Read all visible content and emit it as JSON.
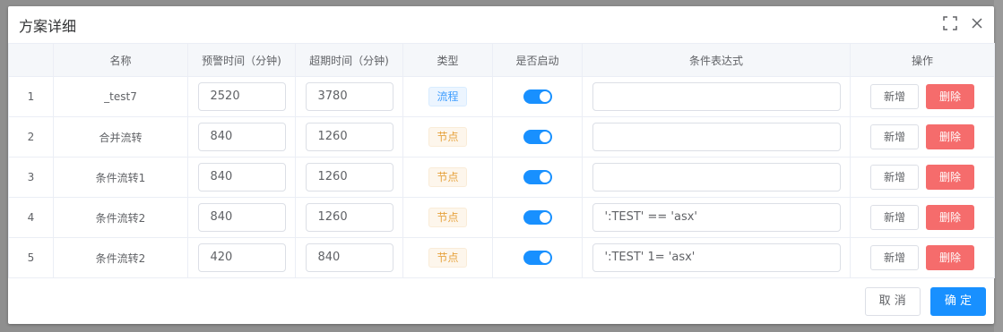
{
  "dialog": {
    "title": "方案详细",
    "fullscreen_icon": "fullscreen-icon",
    "close_icon": "close-icon"
  },
  "table": {
    "headers": [
      "",
      "名称",
      "预警时间（分钟)",
      "超期时间（分钟)",
      "类型",
      "是否启动",
      "条件表达式",
      "操作"
    ],
    "rows": [
      {
        "index": "1",
        "name": "_test7",
        "warn": "2520",
        "overdue": "3780",
        "type": "流程",
        "type_color": "blue",
        "enabled": true,
        "expr": "",
        "add": "新增",
        "delete": "删除"
      },
      {
        "index": "2",
        "name": "合并流转",
        "warn": "840",
        "overdue": "1260",
        "type": "节点",
        "type_color": "orange",
        "enabled": true,
        "expr": "",
        "add": "新增",
        "delete": "删除"
      },
      {
        "index": "3",
        "name": "条件流转1",
        "warn": "840",
        "overdue": "1260",
        "type": "节点",
        "type_color": "orange",
        "enabled": true,
        "expr": "",
        "add": "新增",
        "delete": "删除"
      },
      {
        "index": "4",
        "name": "条件流转2",
        "warn": "840",
        "overdue": "1260",
        "type": "节点",
        "type_color": "orange",
        "enabled": true,
        "expr": "':TEST' == 'asx'",
        "add": "新增",
        "delete": "删除"
      },
      {
        "index": "5",
        "name": "条件流转2",
        "warn": "420",
        "overdue": "840",
        "type": "节点",
        "type_color": "orange",
        "enabled": true,
        "expr": "':TEST' 1= 'asx'",
        "add": "新增",
        "delete": "删除"
      }
    ]
  },
  "footer": {
    "cancel_label": "取 消",
    "ok_label": "确 定"
  },
  "colors": {
    "primary": "#1890ff",
    "danger": "#f56c6c",
    "tag_blue": "#409eff",
    "tag_orange": "#e6a23c"
  }
}
